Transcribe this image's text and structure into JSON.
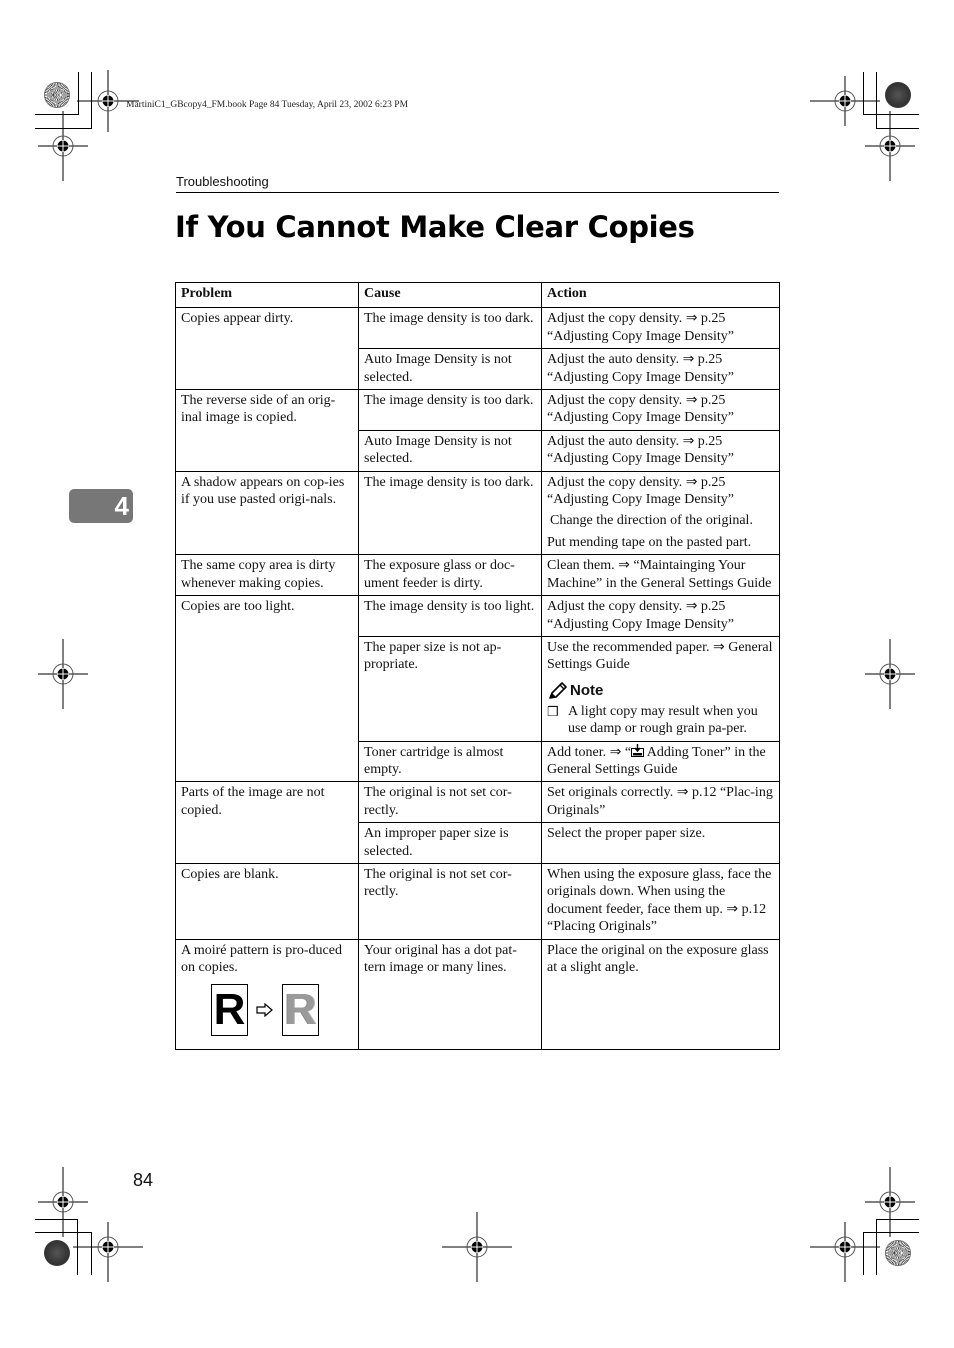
{
  "print_meta": "MartiniC1_GBcopy4_FM.book  Page 84  Tuesday, April 23, 2002  6:23 PM",
  "running_head": "Troubleshooting",
  "page_title": "If You Cannot Make Clear Copies",
  "chapter_tab": "4",
  "page_number": "84",
  "icons": {
    "note": "pencil-icon",
    "checkbox": "checkbox-icon",
    "arrow": "hollow-arrow-right-icon",
    "toner": "toner-icon"
  },
  "table": {
    "headers": [
      "Problem",
      "Cause",
      "Action"
    ],
    "groups": [
      {
        "problem": "Copies appear dirty.",
        "rows": [
          {
            "cause": "The image density is too dark.",
            "action": [
              "Adjust the copy density. ⇒ p.25 “Adjusting Copy Image Density”"
            ]
          },
          {
            "cause": "Auto Image Density is not selected.",
            "action": [
              "Adjust the auto density. ⇒ p.25 “Adjusting Copy Image Density”"
            ]
          }
        ]
      },
      {
        "problem": "The reverse side of an orig-inal image is copied.",
        "rows": [
          {
            "cause": "The image density is too dark.",
            "action": [
              "Adjust the copy density. ⇒ p.25 “Adjusting Copy Image Density”"
            ]
          },
          {
            "cause": "Auto Image Density is not selected.",
            "action": [
              "Adjust the auto density. ⇒ p.25 “Adjusting Copy Image Density”"
            ]
          }
        ]
      },
      {
        "problem": "A shadow appears on cop-ies if you use pasted origi-nals.",
        "rows": [
          {
            "cause": "The image density is too dark.",
            "action": [
              "Adjust the copy density. ⇒ p.25 “Adjusting Copy Image Density”",
              "Change the direction of the original.",
              "Put mending tape on the pasted part."
            ]
          }
        ]
      },
      {
        "problem": "The same copy area is dirty whenever making copies.",
        "rows": [
          {
            "cause": "The exposure glass or doc-ument feeder is dirty.",
            "action": [
              "Clean them. ⇒ “Maintainging Your Machine” in the General Settings Guide"
            ]
          }
        ]
      },
      {
        "problem": "Copies are too light.",
        "rows": [
          {
            "cause": "The image density is too light.",
            "action": [
              "Adjust the copy density. ⇒ p.25 “Adjusting Copy Image Density”"
            ]
          },
          {
            "cause": "The paper size is not ap-propriate.",
            "action": [
              "Use the recommended paper. ⇒ General Settings Guide"
            ],
            "note": {
              "title": "Note",
              "items": [
                "A light copy may result when you use damp or rough grain pa-per."
              ]
            }
          },
          {
            "cause": "Toner cartridge is almost empty.",
            "action_pre": "Add toner. ⇒ “",
            "action_post": " Adding Toner” in the General Settings Guide"
          }
        ]
      },
      {
        "problem": "Parts of the image are not copied.",
        "rows": [
          {
            "cause": "The original is not set cor-rectly.",
            "action": [
              "Set originals correctly. ⇒ p.12 “Plac-ing Originals”"
            ]
          },
          {
            "cause": "An improper paper size is selected.",
            "action": [
              "Select the proper paper size."
            ]
          }
        ]
      },
      {
        "problem": "Copies are blank.",
        "rows": [
          {
            "cause": "The original is not set cor-rectly.",
            "action": [
              "When using the exposure glass, face the originals down. When using the document feeder, face them up. ⇒ p.12 “Placing Originals”"
            ]
          }
        ]
      },
      {
        "problem": "A moiré pattern is pro-duced on copies.",
        "illustration": {
          "before_letter": "R",
          "after_letter": "R"
        },
        "rows": [
          {
            "cause": "Your original has a dot pat-tern image or many lines.",
            "action": [
              "Place the original on the exposure glass at a slight angle."
            ]
          }
        ]
      }
    ]
  }
}
